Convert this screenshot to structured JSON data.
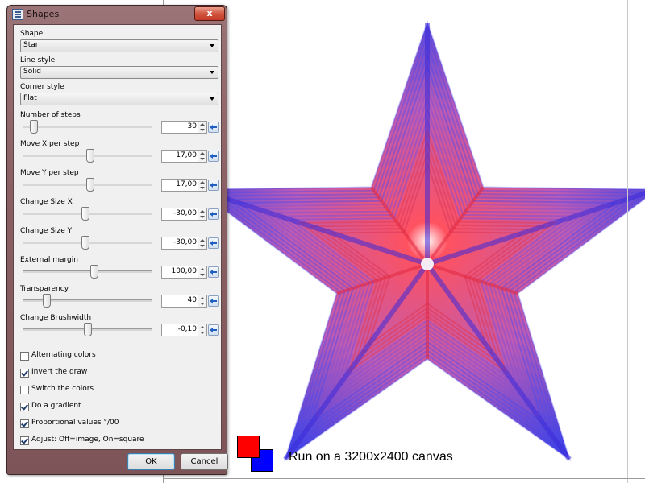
{
  "dialog": {
    "title": "Shapes",
    "close_label": "x",
    "fields": {
      "shape": {
        "label": "Shape",
        "value": "Star"
      },
      "line_style": {
        "label": "Line style",
        "value": "Solid"
      },
      "corner_style": {
        "label": "Corner style",
        "value": "Flat"
      }
    },
    "sliders": [
      {
        "label": "Number of steps",
        "value": "30",
        "level": 0.05
      },
      {
        "label": "Move X per step",
        "value": "17,00",
        "level": 0.52
      },
      {
        "label": "Move Y per step",
        "value": "17,00",
        "level": 0.52
      },
      {
        "label": "Change Size X",
        "value": "-30,00",
        "level": 0.48
      },
      {
        "label": "Change Size Y",
        "value": "-30,00",
        "level": 0.48
      },
      {
        "label": "External margin",
        "value": "100,00",
        "level": 0.55
      },
      {
        "label": "Transparency",
        "value": "40",
        "level": 0.16
      },
      {
        "label": "Change Brushwidth",
        "value": "-0,10",
        "level": 0.5
      }
    ],
    "checkboxes": [
      {
        "label": "Alternating colors",
        "checked": false
      },
      {
        "label": "Invert the draw",
        "checked": true
      },
      {
        "label": "Switch the colors",
        "checked": false
      },
      {
        "label": "Do a gradient",
        "checked": true
      },
      {
        "label": "Proportional values °/00",
        "checked": true
      },
      {
        "label": "Adjust: Off=image, On=square",
        "checked": true
      }
    ],
    "ok_label": "OK",
    "cancel_label": "Cancel"
  },
  "canvas": {
    "caption": "Run on a 3200x2400 canvas",
    "primary_color": "#ff0000",
    "secondary_color": "#0000ff",
    "star_inner_color": "#ff3344",
    "star_outer_color": "#2222dd"
  }
}
